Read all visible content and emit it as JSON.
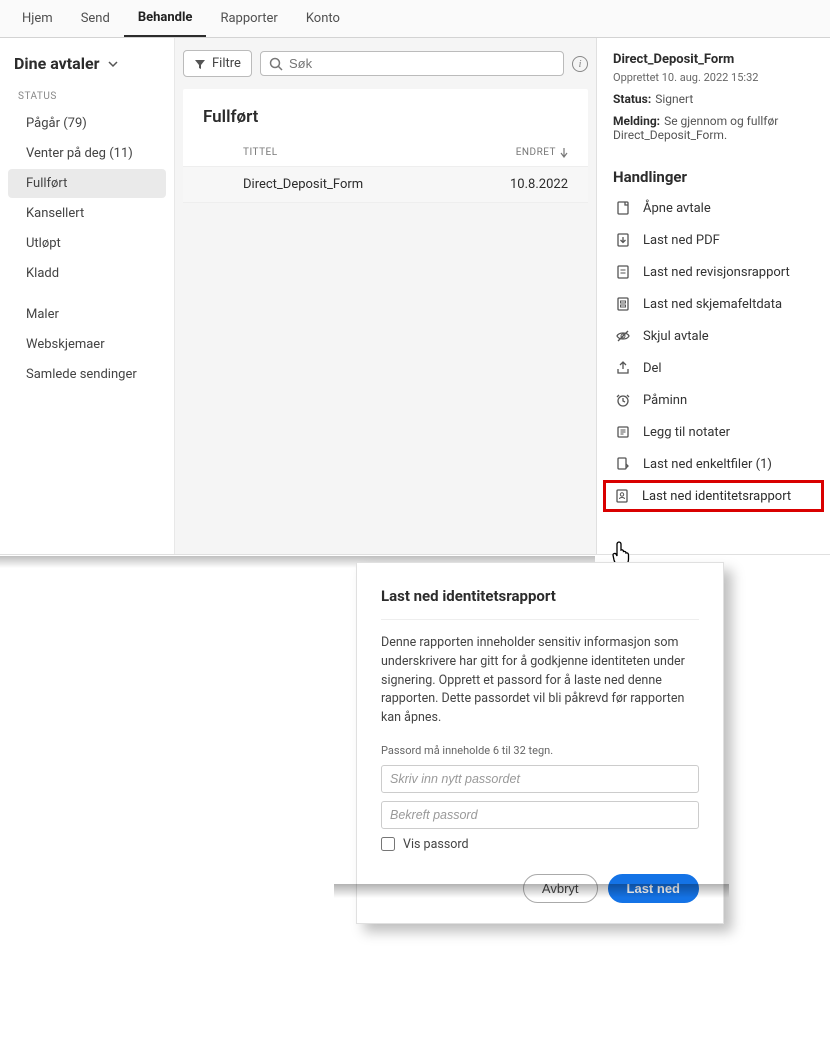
{
  "topnav": {
    "items": [
      "Hjem",
      "Send",
      "Behandle",
      "Rapporter",
      "Konto"
    ],
    "active_index": 2
  },
  "sidebar": {
    "title": "Dine avtaler",
    "status_label": "STATUS",
    "status_items": [
      "Pågår (79)",
      "Venter på deg (11)",
      "Fullført",
      "Kansellert",
      "Utløpt",
      "Kladd"
    ],
    "selected_status_index": 2,
    "other_items": [
      "Maler",
      "Webskjemaer",
      "Samlede sendinger"
    ]
  },
  "toolbar": {
    "filter_label": "Filtre",
    "search_placeholder": "Søk"
  },
  "list": {
    "heading": "Fullført",
    "columns": {
      "title": "TITTEL",
      "edited": "ENDRET"
    },
    "rows": [
      {
        "title": "Direct_Deposit_Form",
        "date": "10.8.2022"
      }
    ]
  },
  "details": {
    "title": "Direct_Deposit_Form",
    "created": "Opprettet 10. aug. 2022 15:32",
    "status_label": "Status:",
    "status_value": "Signert",
    "message_label": "Melding:",
    "message_value": "Se gjennom og fullfør Direct_Deposit_Form."
  },
  "actions": {
    "heading": "Handlinger",
    "items": [
      "Åpne avtale",
      "Last ned PDF",
      "Last ned revisjonsrapport",
      "Last ned skjemafeltdata",
      "Skjul avtale",
      "Del",
      "Påminn",
      "Legg til notater",
      "Last ned enkeltfiler (1)",
      "Last ned identitetsrapport"
    ]
  },
  "dialog": {
    "title": "Last ned identitetsrapport",
    "body": "Denne rapporten inneholder sensitiv informasjon som underskrivere har gitt for å godkjenne identiteten under signering. Opprett et passord for å laste ned denne rapporten. Dette passordet vil bli påkrevd før rapporten kan åpnes.",
    "hint": "Passord må inneholde 6 til 32 tegn.",
    "pw_placeholder": "Skriv inn nytt passordet",
    "pw2_placeholder": "Bekreft passord",
    "show_pw_label": "Vis passord",
    "cancel": "Avbryt",
    "confirm": "Last ned"
  }
}
